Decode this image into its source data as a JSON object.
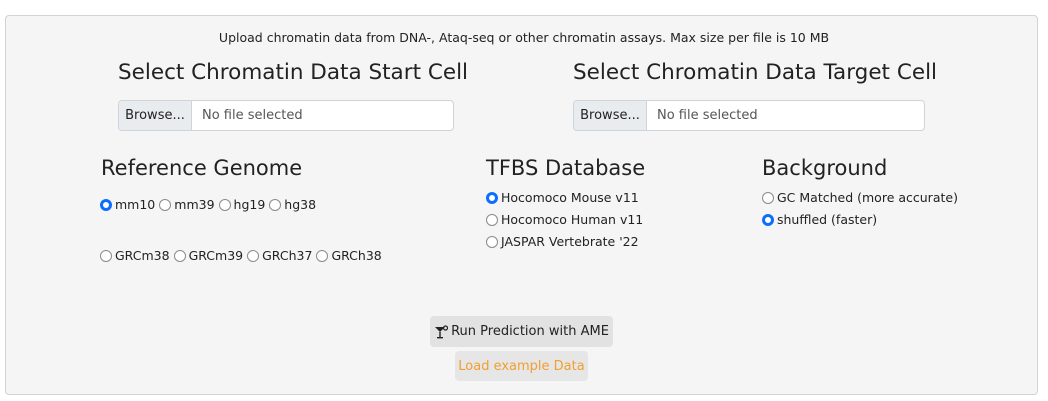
{
  "note": "Upload chromatin data from DNA-, Ataq-seq or other chromatin assays. Max size per file is 10 MB",
  "start_cell": {
    "title": "Select Chromatin Data Start Cell",
    "browse": "Browse...",
    "placeholder": "No file selected"
  },
  "target_cell": {
    "title": "Select Chromatin Data Target Cell",
    "browse": "Browse...",
    "placeholder": "No file selected"
  },
  "reference_genome": {
    "title": "Reference Genome",
    "row1": [
      "mm10",
      "mm39",
      "hg19",
      "hg38"
    ],
    "row2": [
      "GRCm38",
      "GRCm39",
      "GRCh37",
      "GRCh38"
    ],
    "selected": "mm10"
  },
  "tfbs": {
    "title": "TFBS Database",
    "options": [
      "Hocomoco Mouse v11",
      "Hocomoco Human v11",
      "JASPAR Vertebrate '22"
    ],
    "selected": "Hocomoco Mouse v11"
  },
  "background": {
    "title": "Background",
    "options": [
      "GC Matched (more accurate)",
      "shuffled (faster)"
    ],
    "selected": "shuffled (faster)"
  },
  "buttons": {
    "run": "Run Prediction with AME",
    "run_icon": "cocktail-icon",
    "load": "Load example Data"
  },
  "colors": {
    "accent": "#0d6efd",
    "load_text": "#f0a030"
  }
}
